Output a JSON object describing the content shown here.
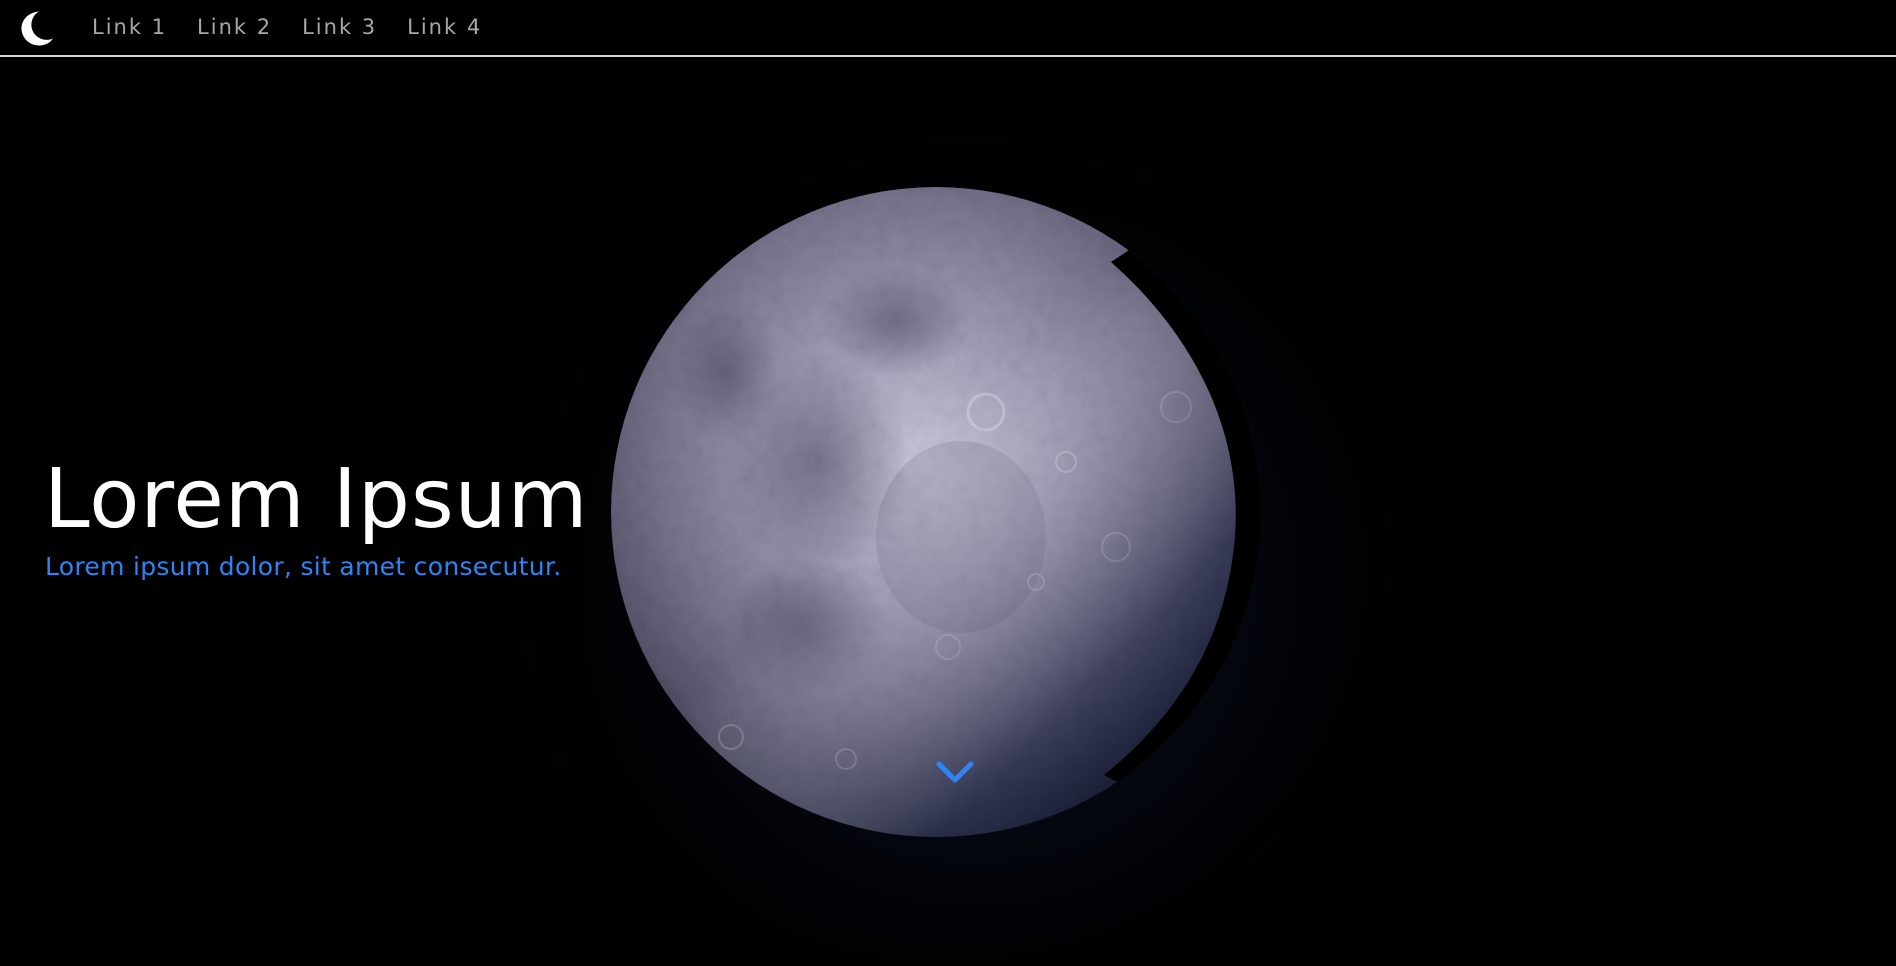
{
  "navbar": {
    "brand_icon": "crescent-moon-icon",
    "links": [
      {
        "label": "Link 1"
      },
      {
        "label": "Link 2"
      },
      {
        "label": "Link 3"
      },
      {
        "label": "Link 4"
      }
    ]
  },
  "hero": {
    "title": "Lorem Ipsum",
    "subtitle": "Lorem ipsum dolor, sit amet consecutur.",
    "scroll_icon": "chevron-down-icon",
    "background_image": "moon-image"
  },
  "colors": {
    "background": "#000000",
    "nav_text": "#a8a8a8",
    "accent": "#2f84f5",
    "title": "#ffffff",
    "nav_border": "#d8d8d8"
  }
}
